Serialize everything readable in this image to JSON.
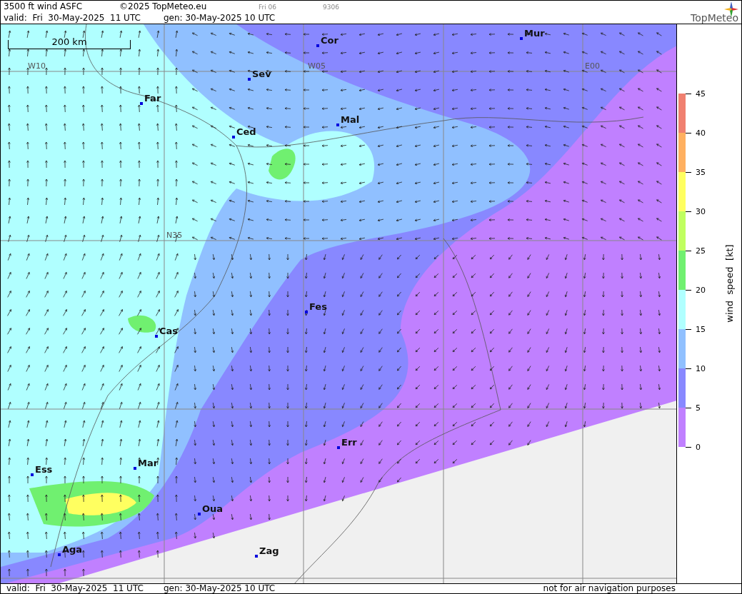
{
  "header": {
    "title": "3500 ft wind ASFC",
    "copyright": "©2025 TopMeteo.eu",
    "run": "Fri 06",
    "code": "9306",
    "valid": "valid:  Fri  30-May-2025  11 UTC",
    "generated": "gen: 30-May-2025 10 UTC",
    "logo": "TopMeteo"
  },
  "map": {
    "scale": "200 km",
    "grid_labels": [
      "W10",
      "W05",
      "E00",
      "N35"
    ],
    "cities": [
      "Cor",
      "Mur",
      "Sev",
      "Far",
      "Mal",
      "Ced",
      "Cas",
      "Fes",
      "Err",
      "Mar",
      "Ess",
      "Oua",
      "Aga",
      "Zag"
    ]
  },
  "legend": {
    "title": "wind  speed  [kt]",
    "ticks": [
      "45",
      "40",
      "35",
      "30",
      "25",
      "20",
      "15",
      "10",
      "5",
      "0"
    ],
    "bands": [
      {
        "color": "#f08070"
      },
      {
        "color": "#ffb060"
      },
      {
        "color": "#ffff60"
      },
      {
        "color": "#c0ff60"
      },
      {
        "color": "#70f070"
      },
      {
        "color": "#b0ffff"
      },
      {
        "color": "#90c0ff"
      },
      {
        "color": "#8888ff"
      },
      {
        "color": "#c080ff"
      }
    ]
  },
  "footer": {
    "valid": "valid:  Fri  30-May-2025  11 UTC",
    "generated": "gen: 30-May-2025 10 UTC",
    "disclaimer": "not for air navigation purposes"
  }
}
